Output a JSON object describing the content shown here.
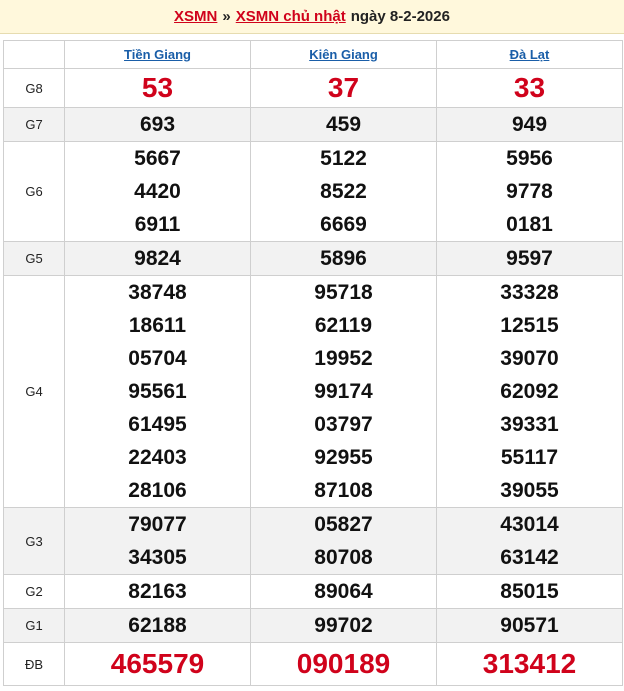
{
  "header": {
    "link1": "XSMN",
    "separator": "»",
    "link2": "XSMN chủ nhật",
    "date": "ngày 8-2-2026"
  },
  "provinces": [
    "Tiền Giang",
    "Kiên Giang",
    "Đà Lạt"
  ],
  "rows": [
    {
      "label": "G8",
      "style": "big",
      "values": [
        [
          "53"
        ],
        [
          "37"
        ],
        [
          "33"
        ]
      ]
    },
    {
      "label": "G7",
      "style": "nums",
      "values": [
        [
          "693"
        ],
        [
          "459"
        ],
        [
          "949"
        ]
      ]
    },
    {
      "label": "G6",
      "style": "nums",
      "values": [
        [
          "5667",
          "4420",
          "6911"
        ],
        [
          "5122",
          "8522",
          "6669"
        ],
        [
          "5956",
          "9778",
          "0181"
        ]
      ]
    },
    {
      "label": "G5",
      "style": "nums",
      "values": [
        [
          "9824"
        ],
        [
          "5896"
        ],
        [
          "9597"
        ]
      ]
    },
    {
      "label": "G4",
      "style": "nums",
      "values": [
        [
          "38748",
          "18611",
          "05704",
          "95561",
          "61495",
          "22403",
          "28106"
        ],
        [
          "95718",
          "62119",
          "19952",
          "99174",
          "03797",
          "92955",
          "87108"
        ],
        [
          "33328",
          "12515",
          "39070",
          "62092",
          "39331",
          "55117",
          "39055"
        ]
      ]
    },
    {
      "label": "G3",
      "style": "nums",
      "values": [
        [
          "79077",
          "34305"
        ],
        [
          "05827",
          "80708"
        ],
        [
          "43014",
          "63142"
        ]
      ]
    },
    {
      "label": "G2",
      "style": "nums",
      "values": [
        [
          "82163"
        ],
        [
          "89064"
        ],
        [
          "85015"
        ]
      ]
    },
    {
      "label": "G1",
      "style": "nums",
      "values": [
        [
          "62188"
        ],
        [
          "99702"
        ],
        [
          "90571"
        ]
      ]
    },
    {
      "label": "ĐB",
      "style": "db",
      "values": [
        [
          "465579"
        ],
        [
          "090189"
        ],
        [
          "313412"
        ]
      ]
    }
  ]
}
